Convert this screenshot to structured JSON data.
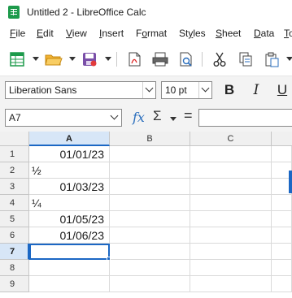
{
  "window": {
    "title": "Untitled 2 - LibreOffice Calc"
  },
  "menu": [
    {
      "label": "File",
      "acc": "F",
      "rest": "ile"
    },
    {
      "label": "Edit",
      "acc": "E",
      "rest": "dit"
    },
    {
      "label": "View",
      "acc": "V",
      "rest": "iew"
    },
    {
      "label": "Insert",
      "acc": "I",
      "rest": "nsert"
    },
    {
      "label": "Format",
      "acc": "o",
      "pre": "F",
      "rest": "rmat"
    },
    {
      "label": "Styles",
      "acc": "y",
      "pre": "St",
      "rest": "les"
    },
    {
      "label": "Sheet",
      "acc": "S",
      "rest": "heet"
    },
    {
      "label": "Data",
      "acc": "D",
      "rest": "ata"
    },
    {
      "label": "To",
      "acc": "T",
      "rest": "o"
    }
  ],
  "formatting": {
    "font_name": "Liberation Sans",
    "font_size": "10 pt",
    "bold": "B",
    "italic": "I",
    "underline": "U"
  },
  "formula_bar": {
    "name_box": "A7",
    "fx": "fx",
    "sigma": "Σ",
    "equals": "=",
    "content": ""
  },
  "sheet": {
    "columns": [
      "A",
      "B",
      "C"
    ],
    "selected_column": "A",
    "rows": [
      {
        "n": "1",
        "a": "01/01/23",
        "a_align": "num"
      },
      {
        "n": "2",
        "a": "½",
        "a_align": "text"
      },
      {
        "n": "3",
        "a": "01/03/23",
        "a_align": "num"
      },
      {
        "n": "4",
        "a": "¼",
        "a_align": "text"
      },
      {
        "n": "5",
        "a": "01/05/23",
        "a_align": "num"
      },
      {
        "n": "6",
        "a": "01/06/23",
        "a_align": "num"
      },
      {
        "n": "7",
        "a": "",
        "a_align": "text"
      },
      {
        "n": "8",
        "a": "",
        "a_align": "text"
      },
      {
        "n": "9",
        "a": "",
        "a_align": "text"
      }
    ],
    "active_cell": "A7",
    "active_row": "7"
  },
  "colors": {
    "selection": "#1b67c4",
    "header_selected": "#d7e6f7",
    "app_green": "#1d9a4b"
  }
}
